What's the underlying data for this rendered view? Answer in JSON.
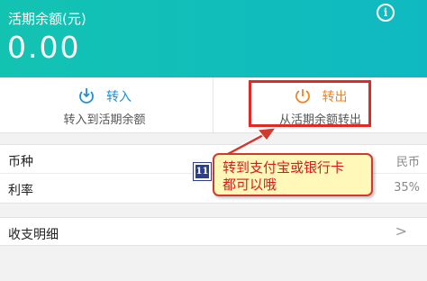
{
  "header": {
    "title": "活期余额(元)",
    "balance": "0.00",
    "info_label": "i"
  },
  "actions": [
    {
      "label": "转入",
      "description": "转入到活期余额",
      "icon": "transfer-in-icon",
      "color": "#1e90d6"
    },
    {
      "label": "转出",
      "description": "从活期余额转出",
      "icon": "transfer-out-icon",
      "color": "#f08322"
    }
  ],
  "info": [
    {
      "label": "币种",
      "value": "民币"
    },
    {
      "label": "利率",
      "value": "35%"
    }
  ],
  "detail": {
    "label": "收支明细",
    "chevron": ">"
  },
  "annotation": {
    "number": "11",
    "text_line1": "转到支付宝或银行卡",
    "text_line2": "都可以哦"
  },
  "colors": {
    "header_bg": "#13c3b2",
    "highlight_border": "#e02a26",
    "callout_bg": "#fff8b8",
    "callout_text": "#d91c1c"
  }
}
